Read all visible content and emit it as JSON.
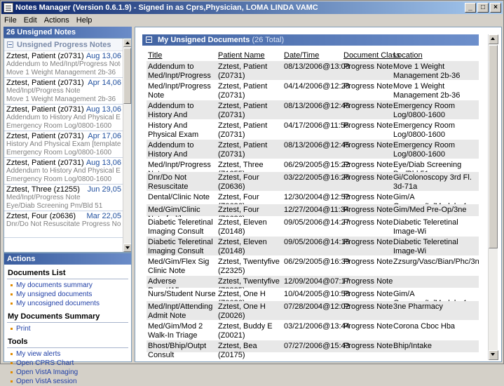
{
  "window": {
    "title": "Notes Manager (Version 0.6.1.9) - Signed in as Cprs,Physician, LOMA LINDA VAMC",
    "min_label": "_",
    "max_label": "□",
    "close_label": "×"
  },
  "menu": [
    "File",
    "Edit",
    "Actions",
    "Help"
  ],
  "left": {
    "header": "26 Unsigned Notes",
    "group": "Unsigned Progress Notes",
    "notes": [
      {
        "name": "Zztest, Patient  (z0731)",
        "date": "Aug 13,06",
        "l1": "Addendum to Med/Inpt/Progress Note",
        "l2": "Move 1 Weight Management 2b-36"
      },
      {
        "name": "Zztest, Patient  (z0731)",
        "date": "Apr 14,06",
        "l1": "Med/Inpt/Progress Note",
        "l2": "Move 1 Weight Management 2b-36"
      },
      {
        "name": "Zztest, Patient  (z0731)",
        "date": "Aug 13,06",
        "l1": "Addendum to History And Physical Exam [templ",
        "l2": "Emergency Room Log/0800-1600"
      },
      {
        "name": "Zztest, Patient  (z0731)",
        "date": "Apr 17,06",
        "l1": "History And Physical Exam [template]",
        "l2": "Emergency Room Log/0800-1600"
      },
      {
        "name": "Zztest, Patient  (z0731)",
        "date": "Aug 13,06",
        "l1": "Addendum to History And Physical Exam [templ",
        "l2": "Emergency Room Log/0800-1600"
      },
      {
        "name": "Zztest, Three  (z1255)",
        "date": "Jun 29,05",
        "l1": "Med/Inpt/Progress Note",
        "l2": "Eye/Diab Screening Pm/Bld 51"
      },
      {
        "name": "Zztest, Four  (z0636)",
        "date": "Mar 22,05",
        "l1": "Dnr/Do Not Resuscitate Progress Note",
        "l2": ""
      }
    ],
    "actions_header": "Actions",
    "sections": [
      {
        "title": "Documents List",
        "links": [
          "My documents summary",
          "My unsigned documents",
          "My uncosigned documents"
        ]
      },
      {
        "title": "My Documents Summary",
        "links": [
          "Print"
        ]
      },
      {
        "title": "Tools",
        "links": [
          "My view alerts",
          "Open CPRS Chart",
          "Open VistA Imaging",
          "Open VistA session"
        ]
      }
    ]
  },
  "main": {
    "title": "My Unsigned Documents",
    "count": "(26 Total)",
    "columns": [
      "Title",
      "Patient Name",
      "Date/Time",
      "Document Class",
      "Location"
    ],
    "rows": [
      [
        "Addendum to Med/Inpt/Progress Note",
        "Zztest, Patient (Z0731)",
        "08/13/2006@13:08",
        "Progress Note",
        "Move 1 Weight Management 2b-36"
      ],
      [
        "Med/Inpt/Progress Note",
        "Zztest, Patient (Z0731)",
        "04/14/2006@12:28",
        "Progress Note",
        "Move 1 Weight Management 2b-36"
      ],
      [
        "Addendum to History And Physical Exam [template]",
        "Zztest, Patient (Z0731)",
        "08/13/2006@12:46",
        "Progress Note",
        "Emergency Room Log/0800-1600"
      ],
      [
        "History And Physical Exam [template]",
        "Zztest, Patient (Z0731)",
        "04/17/2006@11:56",
        "Progress Note",
        "Emergency Room Log/0800-1600"
      ],
      [
        "Addendum to History And Physical Exam [template]",
        "Zztest, Patient (Z0731)",
        "08/13/2006@12:45",
        "Progress Note",
        "Emergency Room Log/0800-1600"
      ],
      [
        "Med/Inpt/Progress Note",
        "Zztest, Three (Z1255)",
        "06/29/2005@15:22",
        "Progress Note",
        "Eye/Diab Screening Pm/Bld 51"
      ],
      [
        "Dnr/Do Not Resuscitate Progress Note",
        "Zztest, Four (Z0636)",
        "03/22/2005@16:26",
        "Progress Note",
        "Gi/Colonoscopy 3rd Fl. 3d-71a"
      ],
      [
        "Dental/Clinic Note",
        "Zztest, Four (Z0636)",
        "12/30/2004@12:52",
        "Progress Note",
        "Gim/A Gonzaga/Ic/Module 4"
      ],
      [
        "Med/Gim/Clinic Note [pdt]",
        "Zztest, Four (Z0636)",
        "12/27/2004@11:34",
        "Progress Note",
        "Gim/Med Pre-Op/3ne"
      ],
      [
        "Diabetic Teleretinal Imaging Consult",
        "Zztest, Eleven (Z0148)",
        "09/05/2006@14:27",
        "Progress Note",
        "Diabetic Teleretinal Image-Wi"
      ],
      [
        "Diabetic Teleretinal Imaging Consult",
        "Zztest, Eleven (Z0148)",
        "09/05/2006@14:16",
        "Progress Note",
        "Diabetic Teleretinal Image-Wi"
      ],
      [
        "Med/Gim/Flex Sig Clinic Note",
        "Zztest, Twentyfive (Z2325)",
        "06/29/2005@16:39",
        "Progress Note",
        "Zzsurg/Vasc/Bian/Phc/3nw"
      ],
      [
        "Adverse React/Allergy",
        "Zztest, Twentyfive (Z2325)",
        "12/09/2004@07:17",
        "Progress Note",
        ""
      ],
      [
        "Nurs/Student Nurse",
        "Zztest, One H (Z0026)",
        "10/04/2005@10:58",
        "Progress Note",
        "Gim/A Gonzaga/Ic/Module 4"
      ],
      [
        "Med/Inpt/Attending Admit Note",
        "Zztest, One H (Z0026)",
        "07/28/2004@12:02",
        "Progress Note",
        "3ne Pharmacy"
      ],
      [
        "Med/Gim/Mod 2 Walk-In Triage",
        "Zztest, Buddy E (Z0021)",
        "03/21/2006@13:44",
        "Progress Note",
        "Corona Cboc Hba"
      ],
      [
        "Bhost/Bhip/Outpt Consult",
        "Zztest, Bea (Z0175)",
        "07/27/2006@15:43",
        "Progress Note",
        "Bhip/Intake"
      ]
    ]
  }
}
